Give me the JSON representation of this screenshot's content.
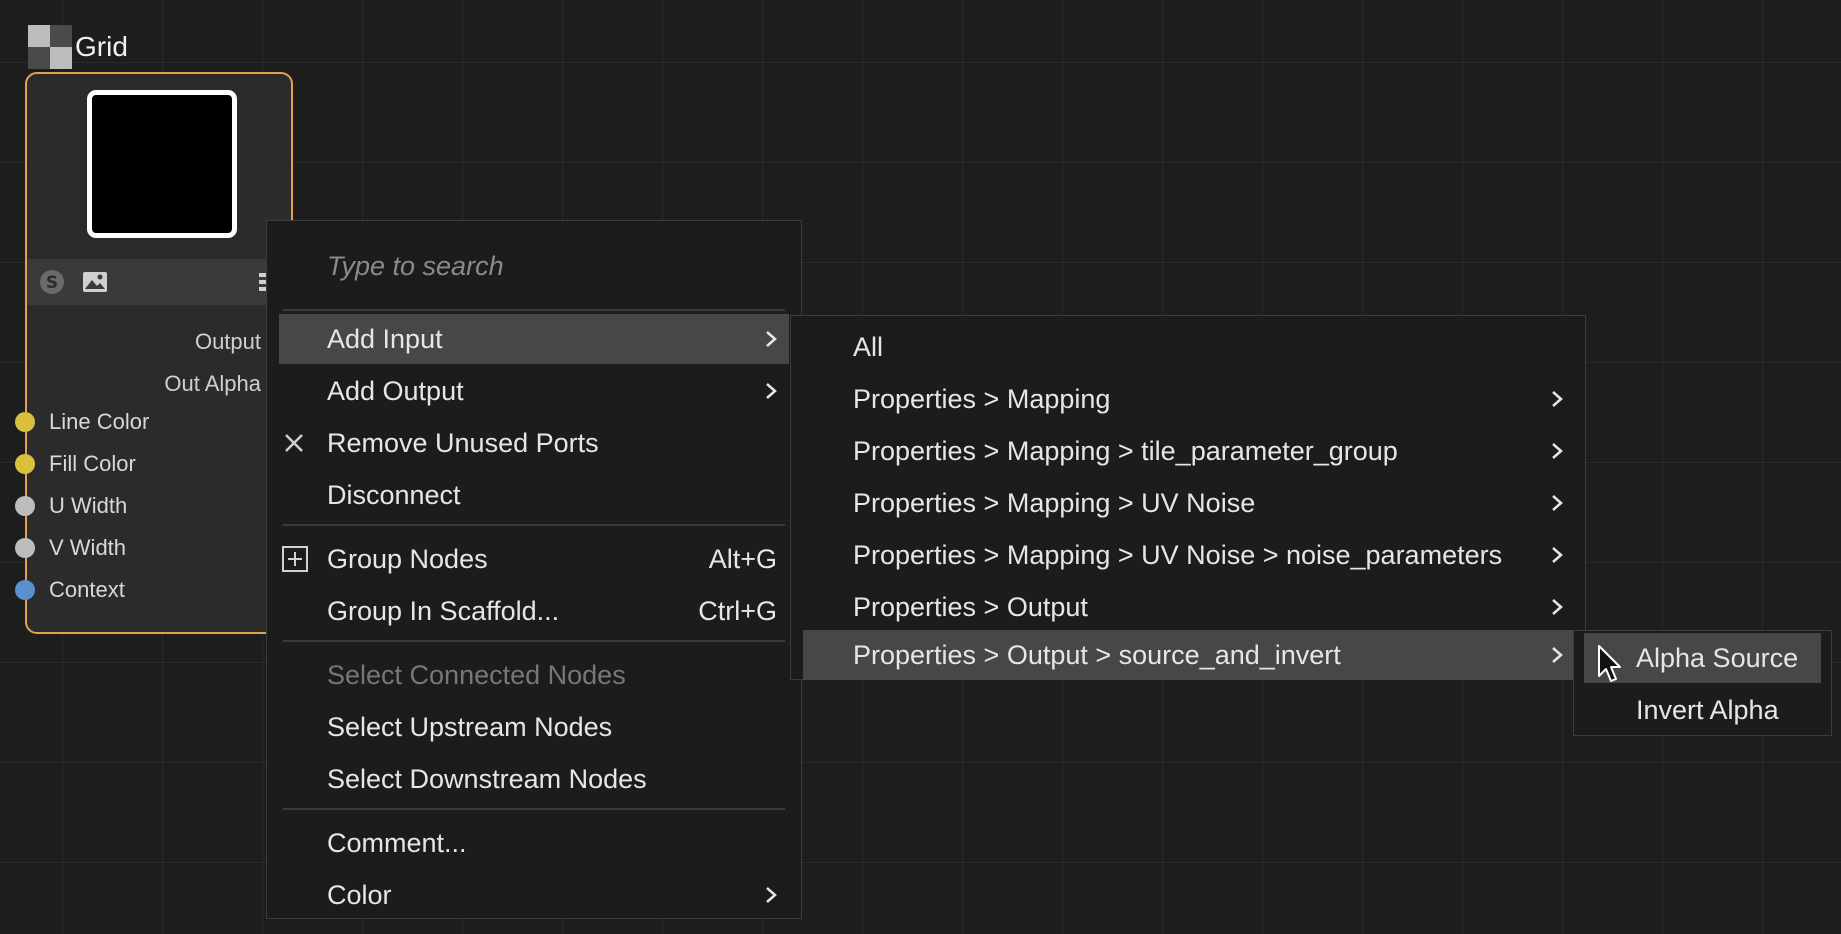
{
  "node": {
    "title": "Grid",
    "outputs": [
      "Output",
      "Out Alpha"
    ],
    "inputs": [
      {
        "label": "Line Color",
        "color": "#d8bf3c"
      },
      {
        "label": "Fill Color",
        "color": "#d8bf3c"
      },
      {
        "label": "U Width",
        "color": "#bdbdbd"
      },
      {
        "label": "V Width",
        "color": "#bdbdbd"
      },
      {
        "label": "Context",
        "color": "#5a8fd0"
      }
    ],
    "border_color": "#e3a04f"
  },
  "context_menu": {
    "search_placeholder": "Type to search",
    "items": [
      {
        "label": "Add Input",
        "submenu": true,
        "highlighted": true
      },
      {
        "label": "Add Output",
        "submenu": true
      },
      {
        "label": "Remove Unused Ports",
        "icon": "close-icon"
      },
      {
        "label": "Disconnect"
      },
      {
        "label": "Group Nodes",
        "icon": "group-plus-icon",
        "shortcut": "Alt+G"
      },
      {
        "label": "Group In Scaffold...",
        "shortcut": "Ctrl+G"
      },
      {
        "label": "Select Connected Nodes",
        "disabled": true
      },
      {
        "label": "Select Upstream Nodes"
      },
      {
        "label": "Select Downstream Nodes"
      },
      {
        "label": "Comment..."
      },
      {
        "label": "Color",
        "submenu": true
      }
    ]
  },
  "add_input_submenu": {
    "items": [
      {
        "label": "All"
      },
      {
        "label": "Properties > Mapping",
        "submenu": true
      },
      {
        "label": "Properties > Mapping > tile_parameter_group",
        "submenu": true
      },
      {
        "label": "Properties > Mapping > UV Noise",
        "submenu": true
      },
      {
        "label": "Properties > Mapping > UV Noise > noise_parameters",
        "submenu": true
      },
      {
        "label": "Properties > Output",
        "submenu": true
      },
      {
        "label": "Properties > Output > source_and_invert",
        "submenu": true,
        "highlighted": true
      }
    ]
  },
  "source_invert_submenu": {
    "items": [
      {
        "label": "Alpha Source",
        "highlighted": true
      },
      {
        "label": "Invert Alpha"
      }
    ]
  }
}
